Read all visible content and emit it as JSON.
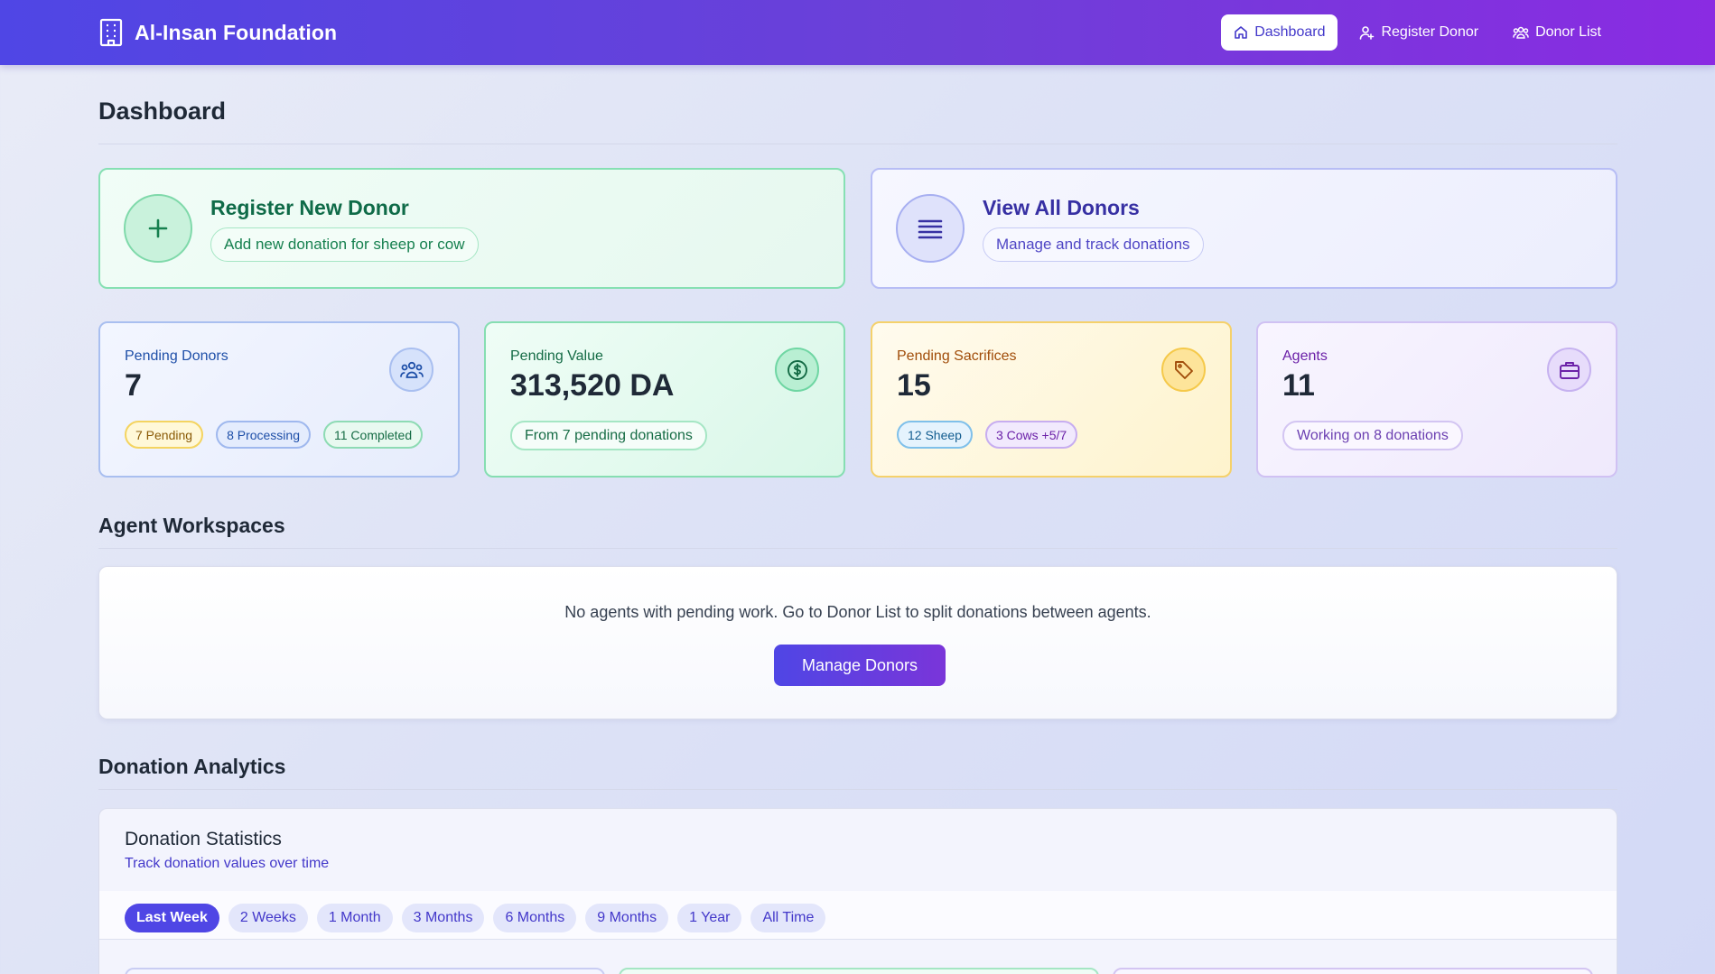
{
  "app": {
    "title": "Al-Insan Foundation"
  },
  "nav": {
    "items": [
      {
        "label": "Dashboard",
        "icon": "home-icon",
        "active": true
      },
      {
        "label": "Register Donor",
        "icon": "user-plus-icon",
        "active": false
      },
      {
        "label": "Donor List",
        "icon": "users-icon",
        "active": false
      }
    ]
  },
  "page": {
    "title": "Dashboard"
  },
  "actions": {
    "register": {
      "title": "Register New Donor",
      "subtitle": "Add new donation for sheep or cow",
      "icon": "plus-icon"
    },
    "view": {
      "title": "View All Donors",
      "subtitle": "Manage and track donations",
      "icon": "list-icon"
    }
  },
  "stats": {
    "pending_donors": {
      "label": "Pending Donors",
      "value": "7",
      "icon": "users-group-icon",
      "badges": [
        "7 Pending",
        "8 Processing",
        "11 Completed"
      ]
    },
    "pending_value": {
      "label": "Pending Value",
      "value": "313,520 DA",
      "icon": "dollar-circle-icon",
      "note": "From 7 pending donations"
    },
    "pending_sacrifices": {
      "label": "Pending Sacrifices",
      "value": "15",
      "icon": "tag-icon",
      "badges": [
        "12 Sheep",
        "3 Cows +5/7"
      ]
    },
    "agents": {
      "label": "Agents",
      "value": "11",
      "icon": "briefcase-icon",
      "note": "Working on 8 donations"
    }
  },
  "workspaces": {
    "title": "Agent Workspaces",
    "message": "No agents with pending work. Go to Donor List to split donations between agents.",
    "button": "Manage Donors"
  },
  "analytics": {
    "section_title": "Donation Analytics",
    "card_title": "Donation Statistics",
    "card_subtitle": "Track donation values over time",
    "ranges": [
      "Last Week",
      "2 Weeks",
      "1 Month",
      "3 Months",
      "6 Months",
      "9 Months",
      "1 Year",
      "All Time"
    ],
    "active_range": "Last Week"
  },
  "colors": {
    "primary": "#4f46e5",
    "accent": "#8a2be2",
    "green": "#0f6b48",
    "indigo": "#3730a3"
  }
}
